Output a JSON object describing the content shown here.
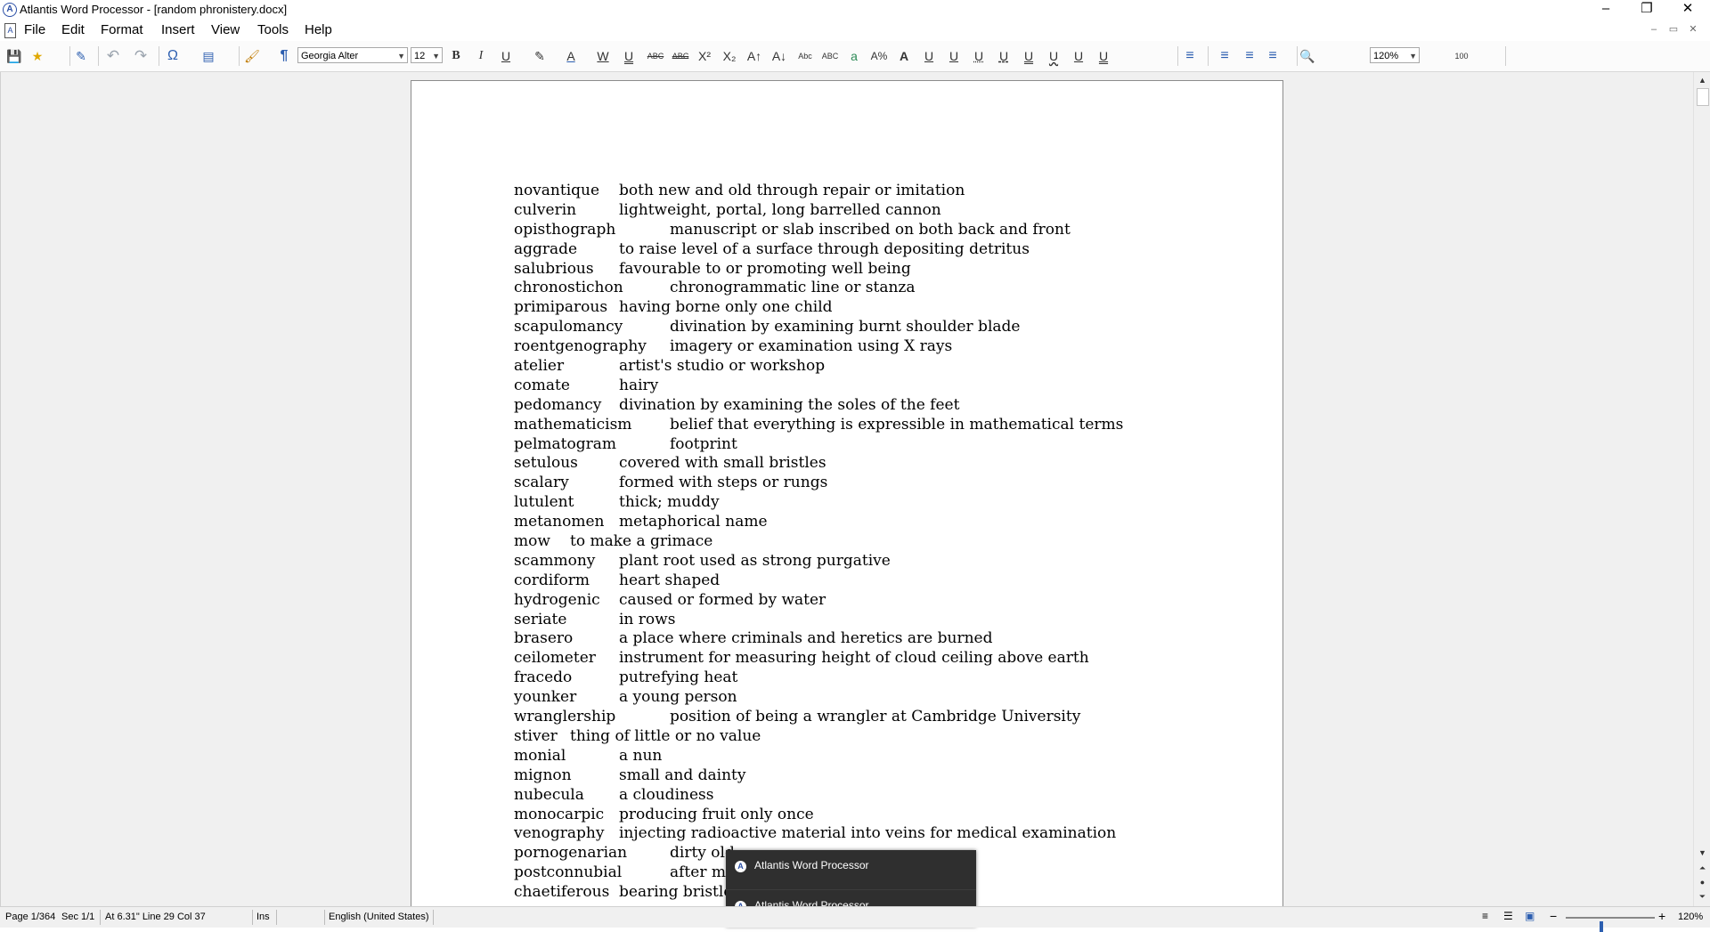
{
  "window": {
    "title": "Atlantis Word Processor - [random phronistery.docx]",
    "app_icon": "A",
    "controls": [
      "–",
      "❐",
      "✕"
    ]
  },
  "menu": {
    "items": [
      "File",
      "Edit",
      "Format",
      "Insert",
      "View",
      "Tools",
      "Help"
    ],
    "mdi_controls": [
      "–",
      "▭",
      "✕"
    ]
  },
  "toolbar": {
    "font_name": "Georgia Alter",
    "font_size": "12",
    "zoom": "120%",
    "icons": {
      "save": "💾",
      "favorites": "★",
      "edit_doc": "✎",
      "undo": "↶",
      "redo": "↷",
      "special_char": "Ω",
      "columns": "▤",
      "format_painter": "🖌",
      "pilcrow": "¶",
      "bold": "B",
      "italic": "I",
      "underline": "U",
      "highlight": "✎",
      "font_color": "A",
      "word_underline": "W",
      "double_underline": "U",
      "strike": "ABC",
      "double_strike": "ABC",
      "superscript": "X²",
      "subscript": "X₂",
      "grow_font": "A↑",
      "shrink_font": "A↓",
      "small_caps": "Abc",
      "all_caps": "ABC",
      "char_shading": "a",
      "char_spacing": "A%",
      "char_outline": "A",
      "align_left": "≡",
      "align_center": "≡",
      "align_right": "≡",
      "justify": "≡",
      "find": "🔍",
      "line_numbering": "100"
    }
  },
  "document": {
    "entries": [
      {
        "word": "novantique",
        "def": "both new and old through repair or imitation",
        "indent": "short"
      },
      {
        "word": "culverin",
        "def": "lightweight, portal, long   barrelled cannon",
        "indent": "short"
      },
      {
        "word": "opisthograph",
        "def": "manuscript or slab inscribed on both back and front",
        "indent": "long"
      },
      {
        "word": "aggrade",
        "def": "to raise level of a surface through depositing detritus",
        "indent": "short"
      },
      {
        "word": "salubrious",
        "def": "favourable to or promoting well  being",
        "indent": "short"
      },
      {
        "word": "chronostichon",
        "def": "chronogrammatic line or stanza",
        "indent": "long"
      },
      {
        "word": "primiparous",
        "def": "having borne only one child",
        "indent": "short"
      },
      {
        "word": "scapulomancy",
        "def": "divination by examining burnt shoulder blade",
        "indent": "long"
      },
      {
        "word": "roentgenography",
        "def": "imagery or examination using X rays",
        "indent": "long"
      },
      {
        "word": "atelier",
        "def": "artist's studio or workshop",
        "indent": "short"
      },
      {
        "word": "comate",
        "def": "hairy",
        "indent": "short"
      },
      {
        "word": "pedomancy",
        "def": "divination by examining the soles of the feet",
        "indent": "short"
      },
      {
        "word": "mathematicism",
        "def": "belief that everything is expressible in mathematical terms",
        "indent": "long"
      },
      {
        "word": "pelmatogram",
        "def": "footprint",
        "indent": "long"
      },
      {
        "word": "setulous",
        "def": "covered with small bristles",
        "indent": "short"
      },
      {
        "word": "scalary",
        "def": "formed with steps or rungs",
        "indent": "short"
      },
      {
        "word": "lutulent",
        "def": "thick; muddy",
        "indent": "short"
      },
      {
        "word": "metanomen",
        "def": "metaphorical name",
        "indent": "short"
      },
      {
        "word": "mow",
        "def": "to make a grimace",
        "indent": "tiny"
      },
      {
        "word": "scammony",
        "def": "plant root used as strong purgative",
        "indent": "short"
      },
      {
        "word": "cordiform",
        "def": "heart shaped",
        "indent": "short"
      },
      {
        "word": "hydrogenic",
        "def": "caused or formed by water",
        "indent": "short"
      },
      {
        "word": "seriate",
        "def": "in rows",
        "indent": "short"
      },
      {
        "word": "brasero",
        "def": "a place where criminals and heretics are burned",
        "indent": "short"
      },
      {
        "word": "ceilometer",
        "def": "instrument for measuring height of cloud ceiling above earth",
        "indent": "short"
      },
      {
        "word": "fracedo",
        "def": "putrefying heat",
        "indent": "short"
      },
      {
        "word": "younker",
        "def": "a young person",
        "indent": "short"
      },
      {
        "word": "wranglership",
        "def": "position of being a wrangler at Cambridge University",
        "indent": "long"
      },
      {
        "word": "stiver",
        "def": "thing of little or no value",
        "indent": "tiny"
      },
      {
        "word": "monial",
        "def": "a nun",
        "indent": "short"
      },
      {
        "word": "mignon",
        "def": "small and dainty",
        "indent": "short"
      },
      {
        "word": "nubecula",
        "def": "a cloudiness",
        "indent": "short"
      },
      {
        "word": "monocarpic",
        "def": "producing fruit only once",
        "indent": "short"
      },
      {
        "word": "venography",
        "def": "injecting radioactive material into veins for medical examination",
        "indent": "short"
      },
      {
        "word": "pornogenarian",
        "def": "dirty old",
        "indent": "long"
      },
      {
        "word": "postconnubial",
        "def": "after m",
        "indent": "long"
      },
      {
        "word": "chaetiferous",
        "def": "bearing bristle",
        "indent": "short"
      }
    ]
  },
  "notifications": [
    {
      "label": "Atlantis Word Processor"
    },
    {
      "label": "Atlantis Word Processor"
    }
  ],
  "status": {
    "page": "Page 1/364",
    "section": "Sec 1/1",
    "position": "At 6.31\"  Line 29  Col 37",
    "mode": "Ins",
    "language": "English (United States)",
    "zoom": "120%",
    "zoom_level": 0.4
  },
  "colors": {
    "accent": "#2d5fb0",
    "workspace": "#f0f0f0",
    "notification_bg": "#2f2f2f"
  }
}
